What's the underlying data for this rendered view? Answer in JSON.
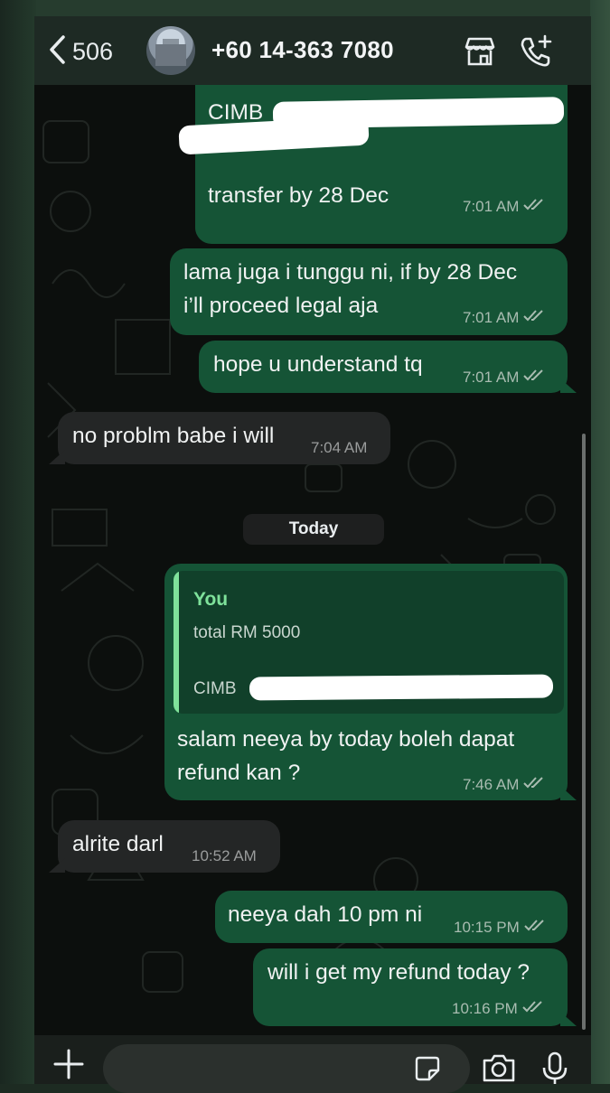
{
  "header": {
    "back_count": "506",
    "contact_title": "+60 14-363 7080",
    "icons": [
      "chevron-left-icon",
      "storefront-icon",
      "add-call-icon"
    ]
  },
  "messages": [
    {
      "id": "m1",
      "direction": "out",
      "lines": [
        "CIMB"
      ],
      "extra_line": "transfer by 28 Dec",
      "time": "7:01 AM",
      "status": "read"
    },
    {
      "id": "m2",
      "direction": "out",
      "lines": [
        "lama juga i tunggu ni, if by 28 Dec",
        "i’ll proceed legal aja"
      ],
      "time": "7:01 AM",
      "status": "read"
    },
    {
      "id": "m3",
      "direction": "out",
      "lines": [
        "hope u understand tq"
      ],
      "time": "7:01 AM",
      "status": "read"
    },
    {
      "id": "m4",
      "direction": "in",
      "lines": [
        "no problm babe i will"
      ],
      "time": "7:04 AM"
    },
    {
      "id": "m5",
      "direction": "out",
      "quote": {
        "author": "You",
        "line1": "total RM 5000",
        "line2": "CIMB"
      },
      "lines": [
        "salam neeya by today boleh dapat",
        "refund kan ?"
      ],
      "time": "7:46 AM",
      "status": "read"
    },
    {
      "id": "m6",
      "direction": "in",
      "lines": [
        "alrite darl"
      ],
      "time": "10:52 AM"
    },
    {
      "id": "m7",
      "direction": "out",
      "lines": [
        "neeya dah 10 pm ni"
      ],
      "time": "10:15 PM",
      "status": "read"
    },
    {
      "id": "m8",
      "direction": "out",
      "lines": [
        "will i get my refund today ?"
      ],
      "time": "10:16 PM",
      "status": "read"
    }
  ],
  "date_separator": "Today",
  "composer": {
    "icons": [
      "plus-icon",
      "sticker-icon",
      "camera-icon",
      "microphone-icon"
    ]
  },
  "colors": {
    "outgoing_bubble": "#155436",
    "incoming_bubble": "#242626",
    "quote_accent": "#7fe29b",
    "chat_background": "#0c0f0d"
  }
}
